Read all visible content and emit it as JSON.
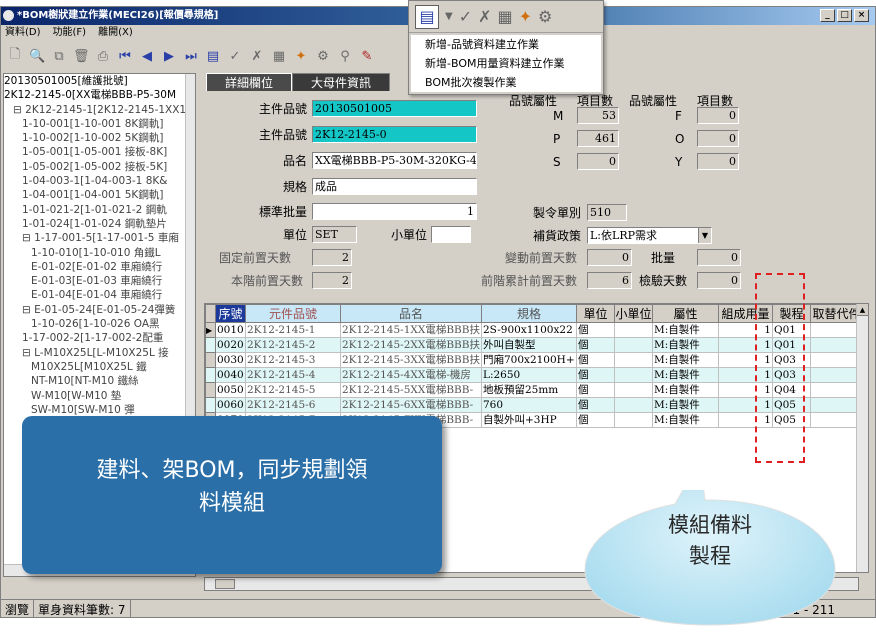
{
  "window": {
    "title": "*BOM樹狀建立作業(MECI26)[報價尋規格]",
    "buttons": [
      "_",
      "□",
      "×"
    ]
  },
  "menu": [
    "資料(D)",
    "功能(F)",
    "離開(X)"
  ],
  "dropdown": {
    "items": [
      "新增-品號資料建立作業",
      "新增-BOM用量資料建立作業",
      "BOM批次複製作業"
    ]
  },
  "tree": {
    "items": [
      "20130501005[維護批號]",
      "2K12-2145-0[XX電梯BBB-P5-30M",
      "⊟ 2K12-2145-1[2K12-2145-1XX1",
      "1-10-001[1-10-001 8K鋼軌]",
      "1-10-002[1-10-002 5K鋼軌]",
      "1-05-001[1-05-001 接板-8K]",
      "1-05-002[1-05-002 接板-5K]",
      "1-04-003-1[1-04-003-1 8K&",
      "1-04-001[1-04-001 5K鋼軌]",
      "1-01-021-2[1-01-021-2 鋼軌",
      "1-01-024[1-01-024 鋼軌墊片",
      "⊟ 1-17-001-5[1-17-001-5 車廂",
      "1-10-010[1-10-010 角鐵L",
      "E-01-02[E-01-02 車廂繞行",
      "E-01-03[E-01-03 車廂繞行",
      "E-01-04[E-01-04 車廂繞行",
      "⊟ E-01-05-24[E-01-05-24彈簧",
      "1-10-026[1-10-026 OA黑",
      "1-17-002-2[1-17-002-2配重",
      "⊟ L-M10X25L[L-M10X25L 接",
      "M10X25L[M10X25L 鐵",
      "NT-M10[NT-M10 鐵絲",
      "W-M10[W-M10 墊",
      "SW-M10[SW-M10 彈",
      "W-M10[W-M10 墊",
      "W-M10[W-M10 墊",
      "W-M10[W-M10 墊",
      "W-M10[W-M10 墊",
      "W-M10[W-M10 墊",
      "W-M10[W-M10 墊",
      "W-M10[W-M10 墊",
      "W-M10[W-M10 墊",
      "W-M10[W-M10 墊",
      "W-M10[W-M10 墊",
      "W-M10[W-M10 墊"
    ]
  },
  "tabs": [
    "詳細欄位",
    "大母件資訊"
  ],
  "form": {
    "main_part_label": "主件品號",
    "main_part_1": "20130501005",
    "main_part_2": "2K12-2145-0",
    "name_label": "品名",
    "name": "XX電梯BBB-P5-30M-320KG-4F4",
    "spec_label": "規格",
    "spec": "成品",
    "std_qty_label": "標準批量",
    "std_qty": "1",
    "unit_label": "單位",
    "unit": "SET",
    "subunit_label": "小單位",
    "subunit": "",
    "fixed_lead_label": "固定前置天數",
    "fixed_lead": "2",
    "this_lead_label": "本階前置天數",
    "this_lead": "2",
    "attr_label": "品號屬性",
    "count_label": "項目數",
    "attr_left": [
      {
        "k": "M",
        "v": "53"
      },
      {
        "k": "P",
        "v": "461"
      },
      {
        "k": "S",
        "v": "0"
      }
    ],
    "attr_right": [
      {
        "k": "F",
        "v": "0"
      },
      {
        "k": "O",
        "v": "0"
      },
      {
        "k": "Y",
        "v": "0"
      }
    ],
    "order_type_label": "製令單別",
    "order_type": "510",
    "supply_label": "補貨政策",
    "supply": "L:依LRP需求",
    "var_lead_label": "變動前置天數",
    "var_lead": "0",
    "batch_label": "批量",
    "batch": "0",
    "cum_lead_label": "前階累計前置天數",
    "cum_lead": "6",
    "inspect_label": "檢驗天數",
    "inspect": "0"
  },
  "grid": {
    "headers": [
      "序號",
      "元件品號",
      "品名",
      "規格",
      "單位",
      "小單位",
      "屬性",
      "組成用量",
      "製程",
      "取替代件"
    ],
    "rows": [
      [
        "0010",
        "2K12-2145-1",
        "2K12-2145-1XX電梯BBB扶",
        "2S-900x1100x22",
        "個",
        "",
        "M:自製件",
        "1",
        "Q01",
        ""
      ],
      [
        "0020",
        "2K12-2145-2",
        "2K12-2145-2XX電梯BBB扶",
        "外叫自製型",
        "個",
        "",
        "M:自製件",
        "1",
        "Q01",
        ""
      ],
      [
        "0030",
        "2K12-2145-3",
        "2K12-2145-3XX電梯BBB扶",
        "門廂700x2100H+",
        "個",
        "",
        "M:自製件",
        "1",
        "Q03",
        ""
      ],
      [
        "0040",
        "2K12-2145-4",
        "2K12-2145-4XX電梯-機房",
        "L:2650",
        "個",
        "",
        "M:自製件",
        "1",
        "Q03",
        ""
      ],
      [
        "0050",
        "2K12-2145-5",
        "2K12-2145-5XX電梯BBB-",
        "地板預留25mm",
        "個",
        "",
        "M:自製件",
        "1",
        "Q04",
        ""
      ],
      [
        "0060",
        "2K12-2145-6",
        "2K12-2145-6XX電梯BBB-",
        "760",
        "個",
        "",
        "M:自製件",
        "1",
        "Q05",
        ""
      ],
      [
        "0070",
        "2K12-2145-7",
        "2K12-2145-7XX電梯BBB-",
        "自製外叫+3HP",
        "個",
        "",
        "M:自製件",
        "1",
        "Q05",
        ""
      ]
    ]
  },
  "status": {
    "mode": "瀏覽",
    "count": "單身資料筆數: 7",
    "version": "6.0.0.1 - 211"
  },
  "callout1": {
    "line1": "建料、架BOM，同步規劃領",
    "line2": "料模組"
  },
  "callout2": {
    "line1": "模組備料",
    "line2": "製程"
  }
}
